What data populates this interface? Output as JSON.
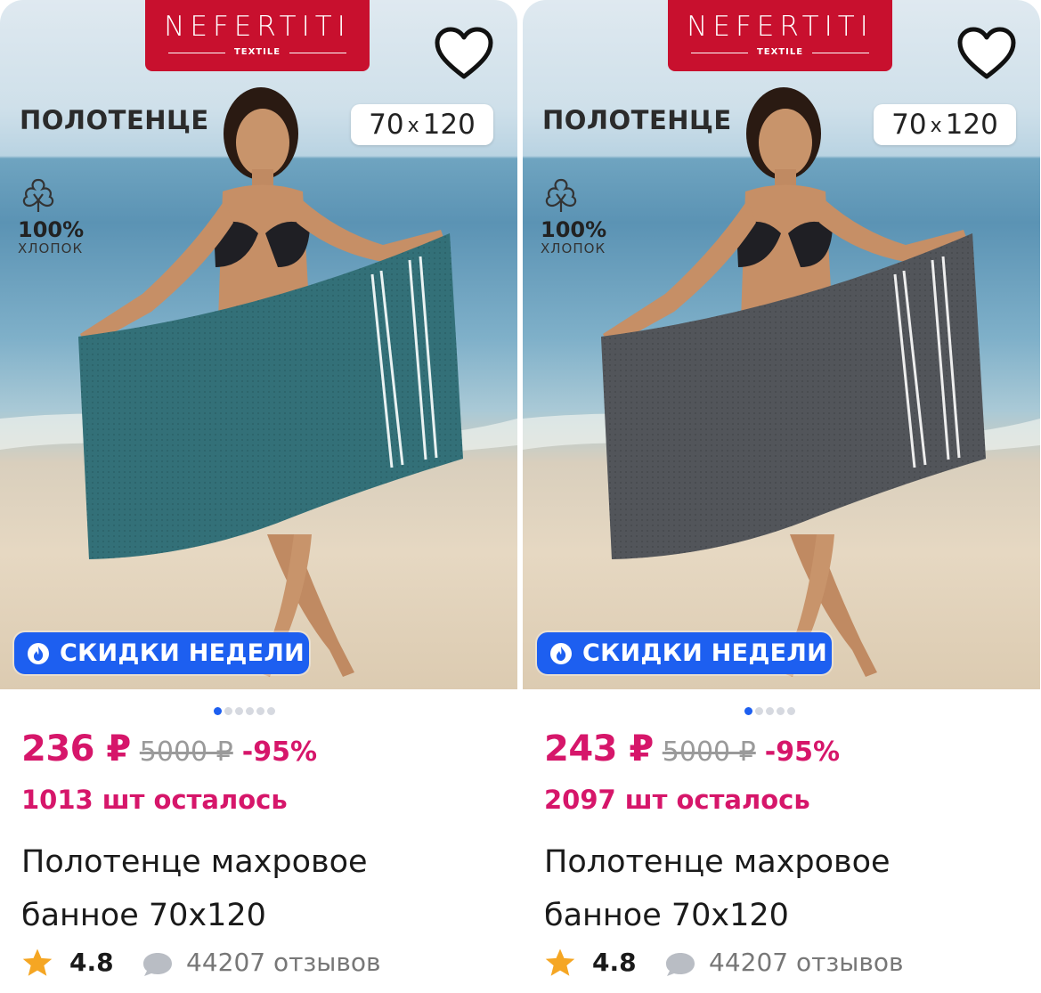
{
  "cards": [
    {
      "brand": {
        "name": "NEFERTITI",
        "sub": "TEXTILE"
      },
      "towel_word": "ПОЛОТЕНЦЕ",
      "size_a": "70",
      "size_x": "x",
      "size_b": "120",
      "cotton_pct": "100%",
      "cotton_txt": "ХЛОПОК",
      "promo": "СКИДКИ НЕДЕЛИ",
      "towel_color": "#2f6a71",
      "carousel": {
        "count": 6,
        "active": 0
      },
      "price_now": "236 ₽",
      "price_old": "5000 ₽",
      "discount": "-95%",
      "stock": "1013 шт осталось",
      "title_line1": "Полотенце махровое",
      "title_line2": "банное 70х120",
      "rating": "4.8",
      "reviews": "44207 отзывов"
    },
    {
      "brand": {
        "name": "NEFERTITI",
        "sub": "TEXTILE"
      },
      "towel_word": "ПОЛОТЕНЦЕ",
      "size_a": "70",
      "size_x": "x",
      "size_b": "120",
      "cotton_pct": "100%",
      "cotton_txt": "ХЛОПОК",
      "promo": "СКИДКИ НЕДЕЛИ",
      "towel_color": "#4d5054",
      "carousel": {
        "count": 5,
        "active": 0
      },
      "price_now": "243 ₽",
      "price_old": "5000 ₽",
      "discount": "-95%",
      "stock": "2097 шт осталось",
      "title_line1": "Полотенце махровое",
      "title_line2": "банное 70х120",
      "rating": "4.8",
      "reviews": "44207 отзывов"
    }
  ],
  "colors": {
    "accent_pink": "#d6166a",
    "brand_red": "#c8102e",
    "promo_blue": "#1d5ff0",
    "star": "#f5a623"
  },
  "icons": [
    "heart-icon",
    "cotton-icon",
    "flame-icon",
    "star-icon",
    "comment-icon"
  ]
}
